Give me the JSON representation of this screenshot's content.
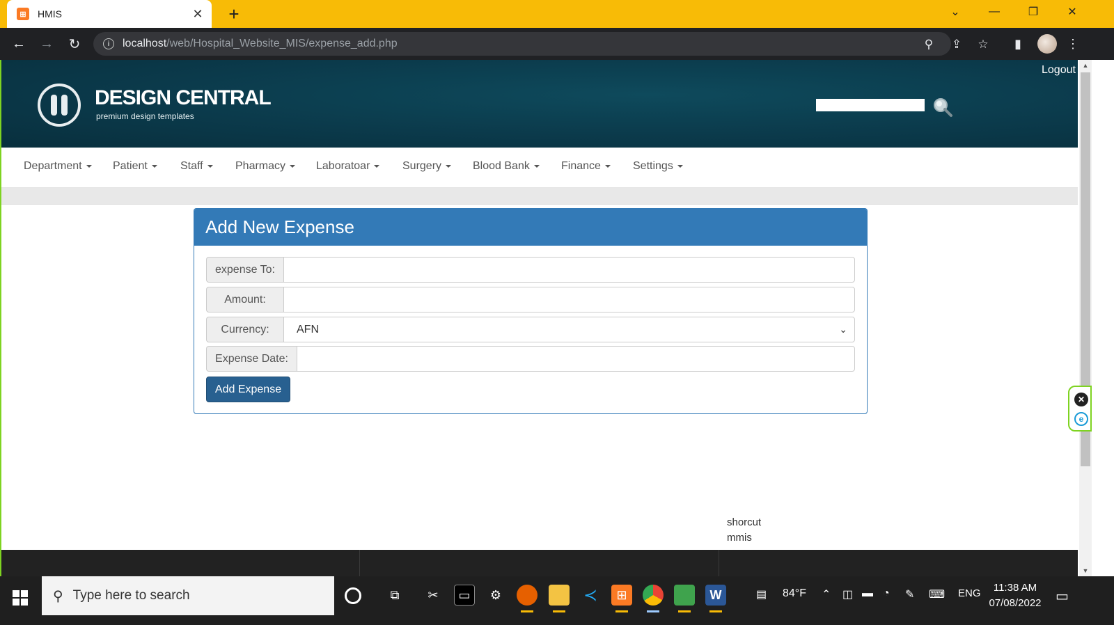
{
  "browser": {
    "tab_title": "HMIS",
    "tab_favicon_text": "⊞",
    "url_host": "localhost",
    "url_path": "/web/Hospital_Website_MIS/expense_add.php"
  },
  "site": {
    "logo_title": "DESIGN CENTRAL",
    "logo_subtitle": "premium design templates",
    "logout_label": "Logout",
    "search_placeholder": ""
  },
  "nav": {
    "items": [
      {
        "label": "Department"
      },
      {
        "label": "Patient"
      },
      {
        "label": "Staff"
      },
      {
        "label": "Pharmacy"
      },
      {
        "label": "Laboratoar"
      },
      {
        "label": "Surgery"
      },
      {
        "label": "Blood Bank"
      },
      {
        "label": "Finance"
      },
      {
        "label": "Settings"
      }
    ]
  },
  "form": {
    "title": "Add New Expense",
    "expense_to_label": "expense To:",
    "expense_to_value": "",
    "amount_label": "Amount:",
    "amount_value": "",
    "currency_label": "Currency:",
    "currency_selected": "AFN",
    "date_label": "Expense Date:",
    "date_value": "",
    "submit_label": "Add Expense"
  },
  "shortcut": {
    "line1": "shorcut",
    "line2": "mmis"
  },
  "taskbar": {
    "search_placeholder": "Type here to search",
    "weather": "84°F",
    "language": "ENG",
    "time": "11:38 AM",
    "date": "07/08/2022"
  },
  "colors": {
    "tab_strip": "#f8bb06",
    "panel_primary": "#337ab7",
    "banner": "#0b3a4b"
  }
}
